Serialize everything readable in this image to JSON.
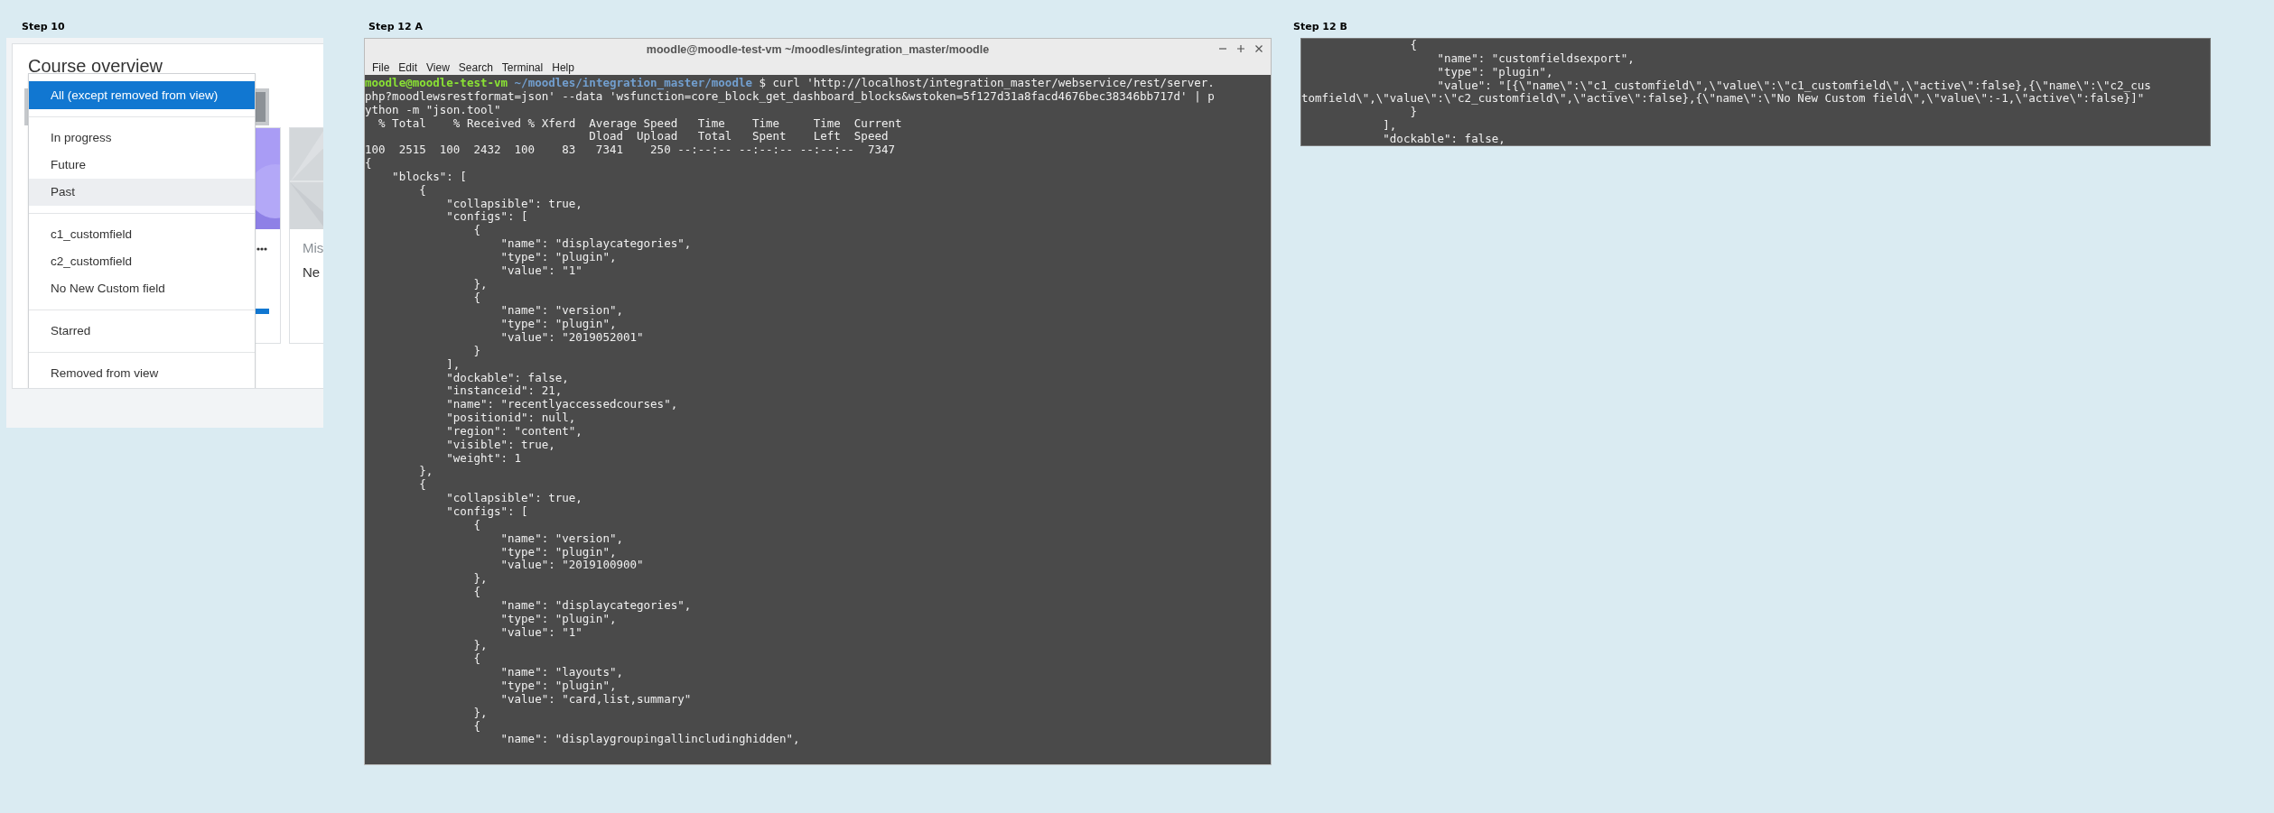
{
  "step10": {
    "label": "Step 10",
    "heading": "Course overview",
    "partial_card": {
      "title": "Mis",
      "text": "Ne"
    },
    "progress": {
      "level": 1
    },
    "dropdown": {
      "groups": [
        {
          "items": [
            {
              "label": "All (except removed from view)",
              "selected": true,
              "hovered": false
            }
          ]
        },
        {
          "items": [
            {
              "label": "In progress",
              "selected": false,
              "hovered": false
            },
            {
              "label": "Future",
              "selected": false,
              "hovered": false
            },
            {
              "label": "Past",
              "selected": false,
              "hovered": true
            }
          ]
        },
        {
          "items": [
            {
              "label": "c1_customfield",
              "selected": false,
              "hovered": false
            },
            {
              "label": "c2_customfield",
              "selected": false,
              "hovered": false
            },
            {
              "label": "No New Custom field",
              "selected": false,
              "hovered": false
            }
          ]
        },
        {
          "items": [
            {
              "label": "Starred",
              "selected": false,
              "hovered": false
            }
          ]
        },
        {
          "items": [
            {
              "label": "Removed from view",
              "selected": false,
              "hovered": false
            }
          ]
        }
      ]
    }
  },
  "step12a": {
    "label": "Step 12 A",
    "window_title": "moodle@moodle-test-vm ~/moodles/integration_master/moodle",
    "menu": [
      "File",
      "Edit",
      "View",
      "Search",
      "Terminal",
      "Help"
    ],
    "prompt": {
      "user_host": "moodle@moodle-test-vm",
      "path": "~/moodles/integration_master/moodle",
      "symbol": "$"
    },
    "command_lines": [
      "curl 'http://localhost/integration_master/webservice/rest/server.",
      "php?moodlewsrestformat=json' --data 'wsfunction=core_block_get_dashboard_blocks&wstoken=5f127d31a8facd4676bec38346bb717d' | p",
      "ython -m \"json.tool\""
    ],
    "output_lines": [
      "  % Total    % Received % Xferd  Average Speed   Time    Time     Time  Current",
      "                                 Dload  Upload   Total   Spent    Left  Speed",
      "100  2515  100  2432  100    83   7341    250 --:--:-- --:--:-- --:--:--  7347",
      "{",
      "    \"blocks\": [",
      "        {",
      "            \"collapsible\": true,",
      "            \"configs\": [",
      "                {",
      "                    \"name\": \"displaycategories\",",
      "                    \"type\": \"plugin\",",
      "                    \"value\": \"1\"",
      "                },",
      "                {",
      "                    \"name\": \"version\",",
      "                    \"type\": \"plugin\",",
      "                    \"value\": \"2019052001\"",
      "                }",
      "            ],",
      "            \"dockable\": false,",
      "            \"instanceid\": 21,",
      "            \"name\": \"recentlyaccessedcourses\",",
      "            \"positionid\": null,",
      "            \"region\": \"content\",",
      "            \"visible\": true,",
      "            \"weight\": 1",
      "        },",
      "        {",
      "            \"collapsible\": true,",
      "            \"configs\": [",
      "                {",
      "                    \"name\": \"version\",",
      "                    \"type\": \"plugin\",",
      "                    \"value\": \"2019100900\"",
      "                },",
      "                {",
      "                    \"name\": \"displaycategories\",",
      "                    \"type\": \"plugin\",",
      "                    \"value\": \"1\"",
      "                },",
      "                {",
      "                    \"name\": \"layouts\",",
      "                    \"type\": \"plugin\",",
      "                    \"value\": \"card,list,summary\"",
      "                },",
      "                {",
      "                    \"name\": \"displaygroupingallincludinghidden\","
    ]
  },
  "step12b": {
    "label": "Step 12 B",
    "output_lines": [
      "                {",
      "                    \"name\": \"customfieldsexport\",",
      "                    \"type\": \"plugin\",",
      "                    \"value\": \"[{\\\"name\\\":\\\"c1_customfield\\\",\\\"value\\\":\\\"c1_customfield\\\",\\\"active\\\":false},{\\\"name\\\":\\\"c2_cus",
      "tomfield\\\",\\\"value\\\":\\\"c2_customfield\\\",\\\"active\\\":false},{\\\"name\\\":\\\"No New Custom field\\\",\\\"value\\\":-1,\\\"active\\\":false}]\"",
      "                }",
      "            ],",
      "            \"dockable\": false,"
    ]
  }
}
